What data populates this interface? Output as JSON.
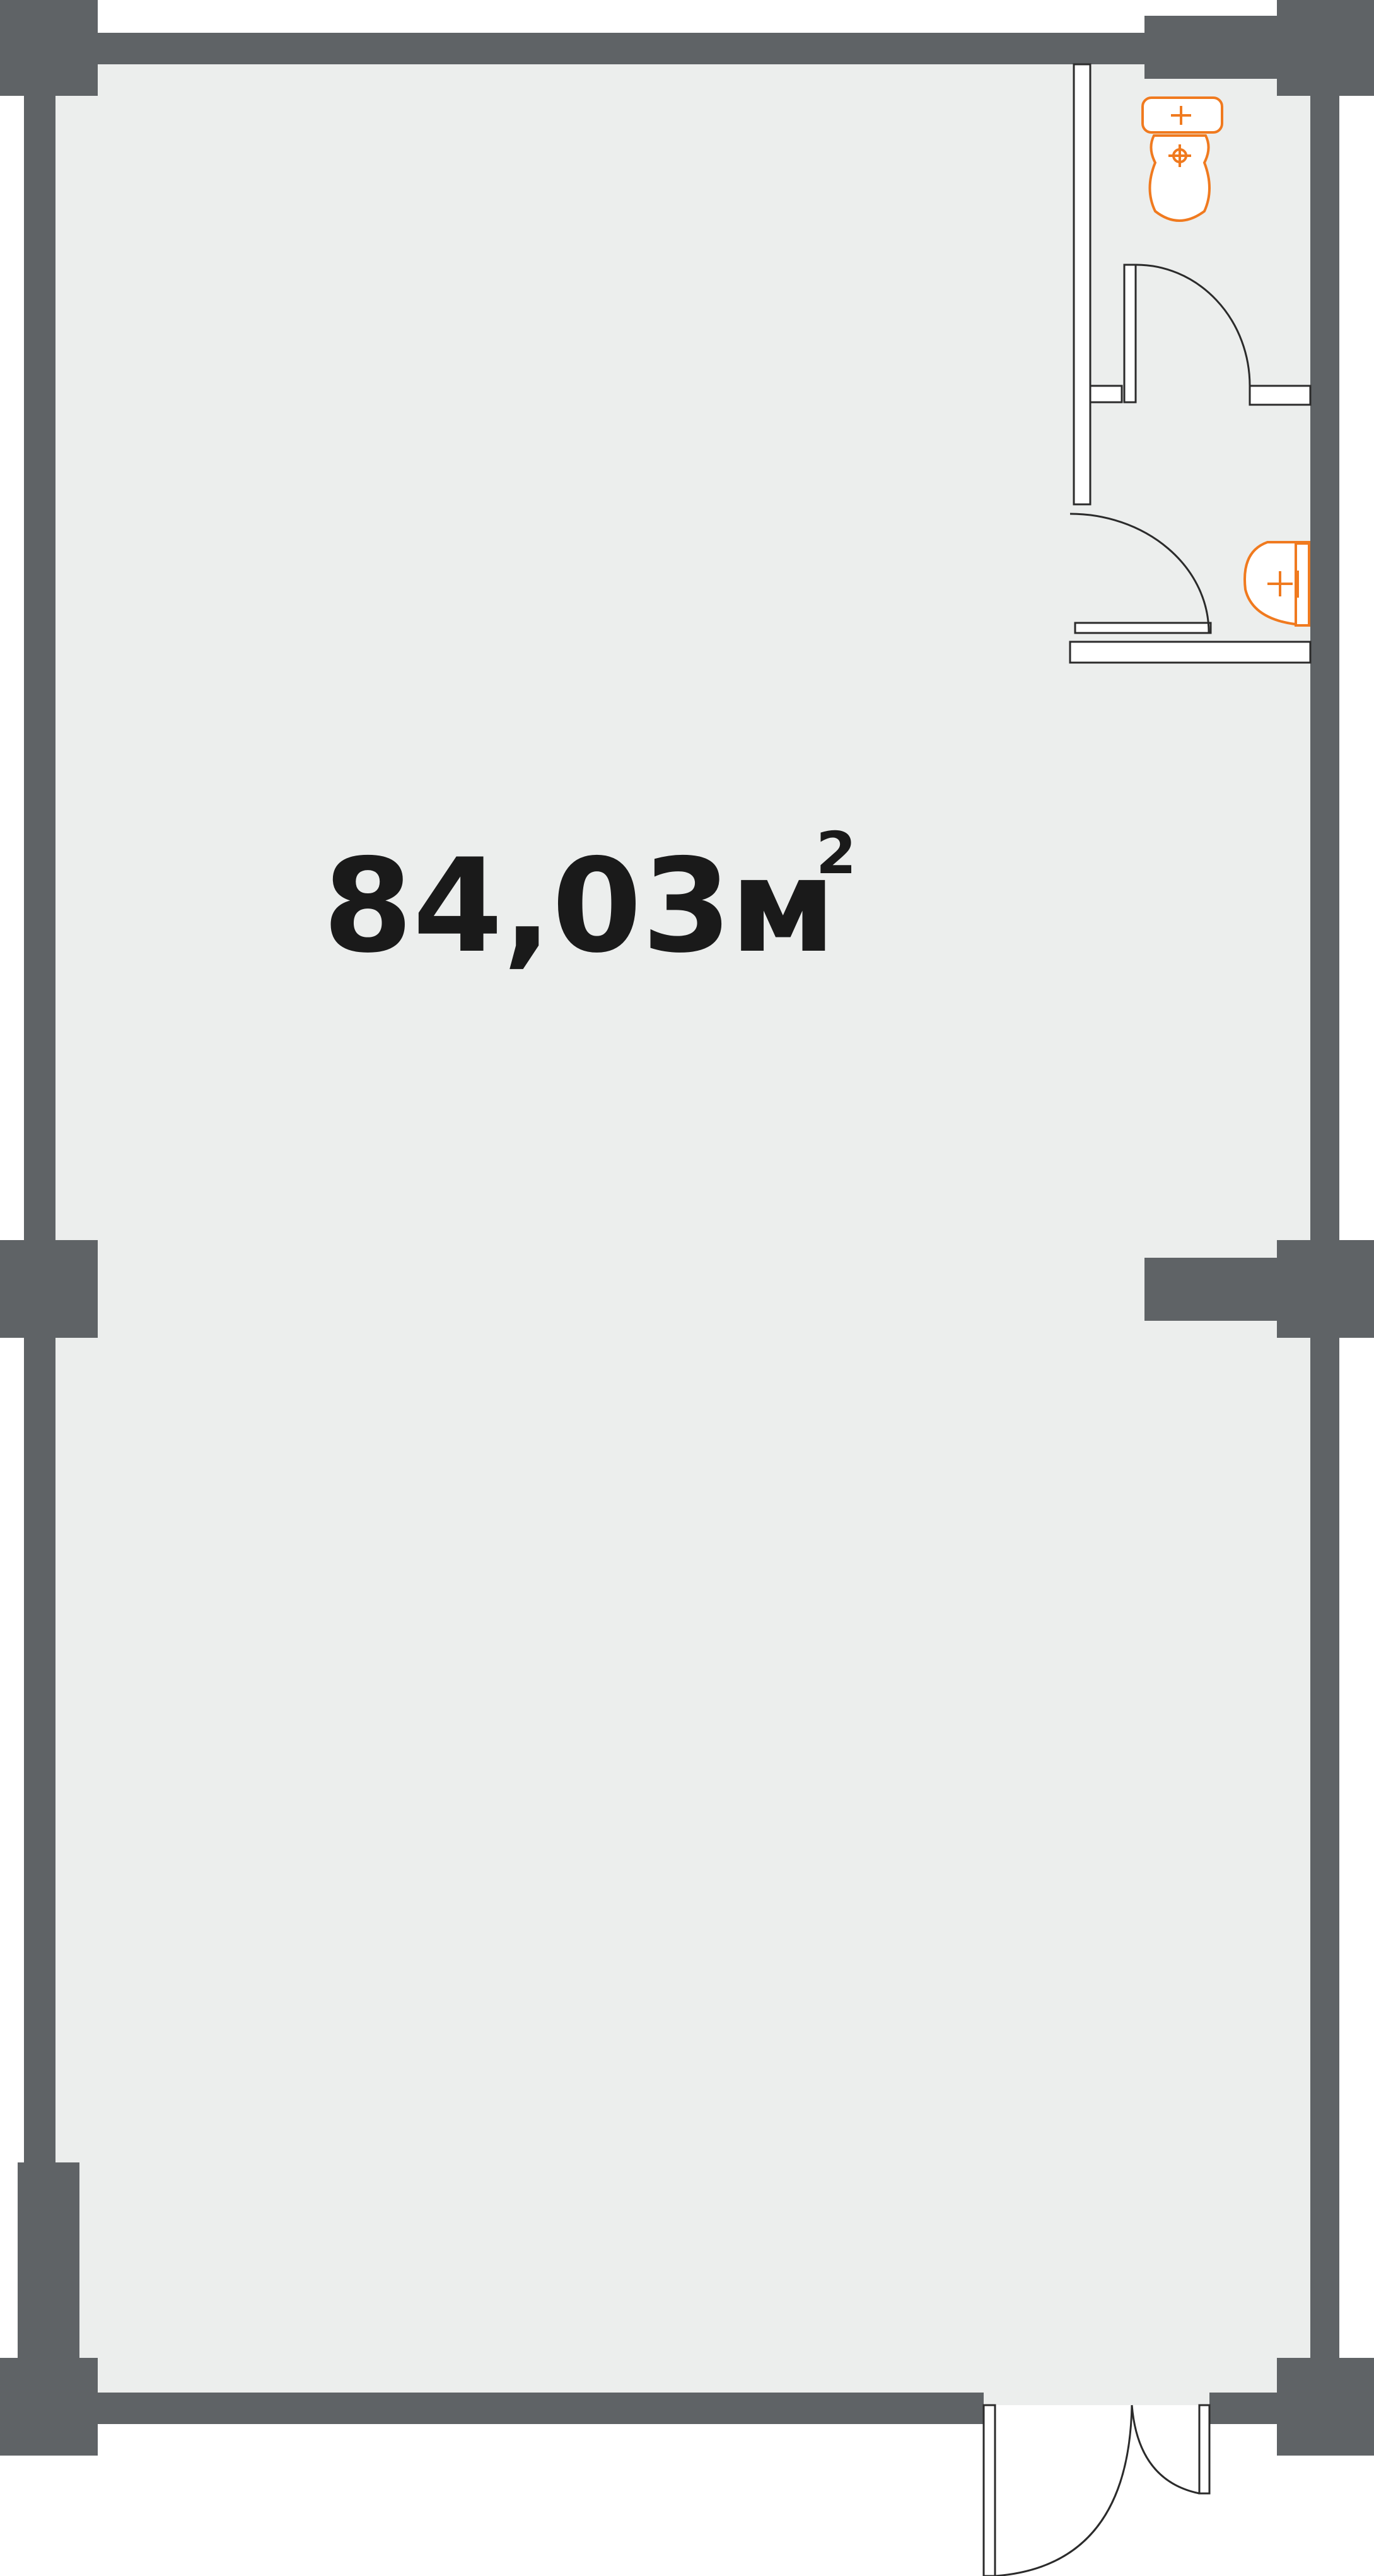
{
  "floor_plan": {
    "area_value": "84,03",
    "area_unit": "м",
    "area_unit_power": "2"
  },
  "colors": {
    "wall": "#5f6366",
    "floor": "#eceeed",
    "fixture": "#f07a1f",
    "line": "#2b2b2b",
    "text": "#1a1a1a"
  },
  "icons": [
    "toilet-icon",
    "sink-icon",
    "door-icon"
  ]
}
